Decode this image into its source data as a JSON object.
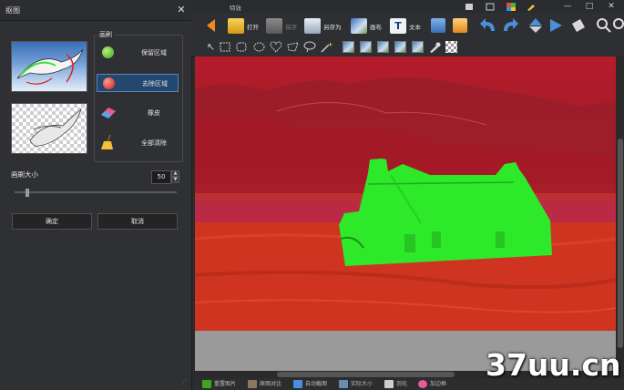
{
  "dialog": {
    "title": "抠图",
    "close": "✕",
    "brush_group": "画刷",
    "tools": [
      {
        "label": "保留区域",
        "selected": false,
        "color": "#3fa51c"
      },
      {
        "label": "去除区域",
        "selected": true,
        "color": "#d21a11"
      },
      {
        "label": "橡皮",
        "selected": false
      },
      {
        "label": "全部清除",
        "selected": false
      }
    ],
    "brush_size_label": "画刷大小",
    "brush_size": "50",
    "ok": "确定",
    "cancel": "取消"
  },
  "app": {
    "title": "特效",
    "window_controls": [
      "—",
      "□",
      "✕"
    ],
    "toolbar": {
      "open": "打开",
      "save": "保存",
      "save_as": "另存为",
      "canvas": "画布",
      "text": "文本"
    },
    "mask_colors": {
      "keep": "#2ee82a",
      "remove": "#c4221f"
    }
  },
  "status_bar": [
    {
      "label": "重置图片"
    },
    {
      "label": "原图对比"
    },
    {
      "label": "自动截图"
    },
    {
      "label": "实际大小"
    },
    {
      "label": "羽化"
    },
    {
      "label": "加边框"
    }
  ],
  "watermark": "37uu.cn"
}
